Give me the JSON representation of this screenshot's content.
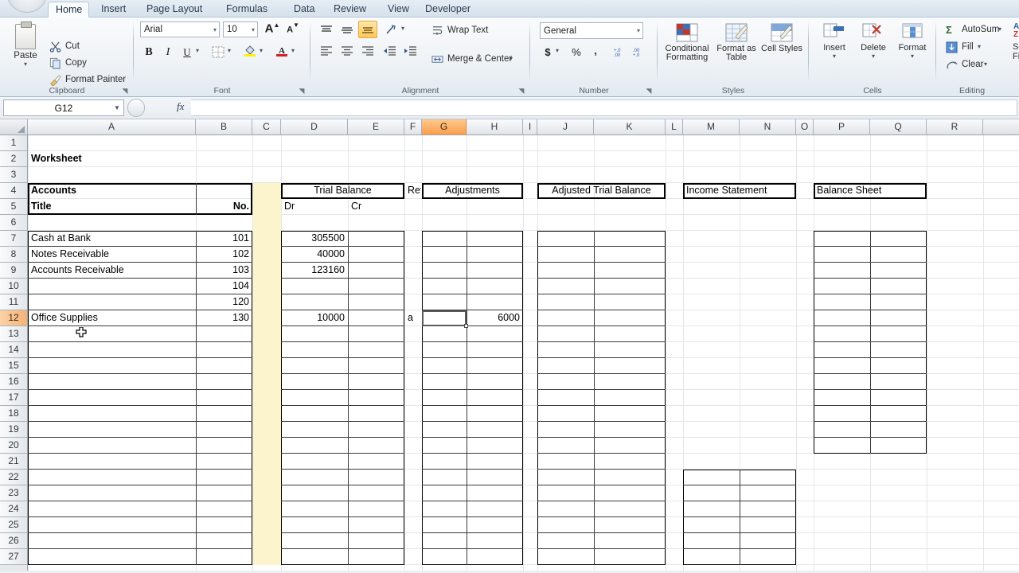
{
  "app": {
    "name_box": "G12",
    "formula_value": ""
  },
  "ribbon": {
    "tabs": [
      {
        "label": "Home",
        "active": true
      },
      {
        "label": "Insert",
        "active": false
      },
      {
        "label": "Page Layout",
        "active": false
      },
      {
        "label": "Formulas",
        "active": false
      },
      {
        "label": "Data",
        "active": false
      },
      {
        "label": "Review",
        "active": false
      },
      {
        "label": "View",
        "active": false
      },
      {
        "label": "Developer",
        "active": false
      }
    ],
    "groups": {
      "clipboard": {
        "label": "Clipboard",
        "paste": "Paste",
        "cut": "Cut",
        "copy": "Copy",
        "format_painter": "Format Painter"
      },
      "font": {
        "label": "Font",
        "font_name": "Arial",
        "font_size": "10",
        "grow_font": "A",
        "shrink_font": "A",
        "bold": "B",
        "italic": "I",
        "underline": "U"
      },
      "alignment": {
        "label": "Alignment",
        "wrap_text": "Wrap Text",
        "merge_center": "Merge & Center"
      },
      "number": {
        "label": "Number",
        "format": "General",
        "currency": "$",
        "percent": "%",
        "comma": ",",
        "inc_decimal": ".00",
        "dec_decimal": ".00"
      },
      "styles": {
        "label": "Styles",
        "conditional_formatting": "Conditional Formatting",
        "format_as_table": "Format as Table",
        "cell_styles": "Cell Styles"
      },
      "cells": {
        "label": "Cells",
        "insert": "Insert",
        "delete": "Delete",
        "format": "Format"
      },
      "editing": {
        "label": "Editing",
        "autosum": "AutoSum",
        "fill": "Fill",
        "clear": "Clear",
        "sort_filter_l1": "So",
        "sort_filter_l2": "Fi"
      }
    }
  },
  "grid": {
    "columns": [
      "A",
      "B",
      "C",
      "D",
      "E",
      "F",
      "G",
      "H",
      "I",
      "J",
      "K",
      "L",
      "M",
      "N",
      "O",
      "P",
      "Q",
      "R"
    ],
    "selected_column": "G",
    "rows": [
      1,
      2,
      3,
      4,
      5,
      6,
      7,
      8,
      9,
      10,
      11,
      12,
      13,
      14,
      15,
      16,
      17,
      18,
      19,
      20,
      21,
      22,
      23,
      24,
      25,
      26,
      27
    ],
    "selected_row": 12,
    "highlight_column_fill": "#fbf4cd",
    "selection_accent": "#fb9d4b"
  },
  "sheet": {
    "title": "Worksheet",
    "section_headers": {
      "accounts": "Accounts",
      "title_col": "Title",
      "no_col": "No.",
      "trial_balance": "Trial Balance",
      "ref": "Ref",
      "adjustments": "Adjustments",
      "adjusted_trial_balance": "Adjusted Trial Balance",
      "income_statement": "Income Statement",
      "balance_sheet": "Balance Sheet",
      "dr": "Dr",
      "cr": "Cr"
    },
    "rows": [
      {
        "row": 7,
        "account": "Cash at Bank",
        "no": "101",
        "tb_dr": "305500",
        "tb_cr": "",
        "ref": "",
        "adj_dr": "",
        "adj_cr": ""
      },
      {
        "row": 8,
        "account": "Notes Receivable",
        "no": "102",
        "tb_dr": "40000",
        "tb_cr": "",
        "ref": "",
        "adj_dr": "",
        "adj_cr": ""
      },
      {
        "row": 9,
        "account": "Accounts Receivable",
        "no": "103",
        "tb_dr": "123160",
        "tb_cr": "",
        "ref": "",
        "adj_dr": "",
        "adj_cr": ""
      },
      {
        "row": 10,
        "account": "",
        "no": "104",
        "tb_dr": "",
        "tb_cr": "",
        "ref": "",
        "adj_dr": "",
        "adj_cr": ""
      },
      {
        "row": 11,
        "account": "",
        "no": "120",
        "tb_dr": "",
        "tb_cr": "",
        "ref": "",
        "adj_dr": "",
        "adj_cr": ""
      },
      {
        "row": 12,
        "account": "Office Supplies",
        "no": "130",
        "tb_dr": "10000",
        "tb_cr": "",
        "ref": "a",
        "adj_dr": "",
        "adj_cr": "6000"
      }
    ]
  }
}
